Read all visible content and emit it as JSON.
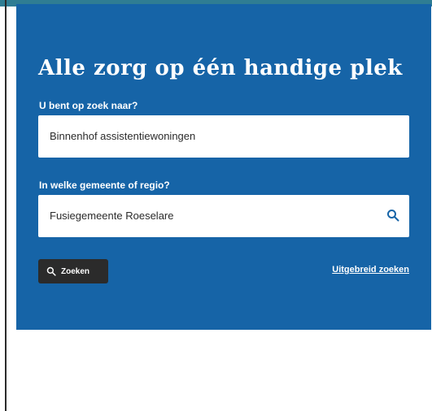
{
  "hero": {
    "title": "Alle zorg op één handige plek",
    "background_color": "#1664a7"
  },
  "search_form": {
    "what_label": "U bent op zoek naar?",
    "what_value": "Binnenhof assistentiewoningen",
    "where_label": "In welke gemeente of regio?",
    "where_value": "Fusiegemeente Roeselare",
    "where_icon": "search-icon",
    "submit_label": "Zoeken",
    "submit_icon": "search-icon",
    "advanced_link": "Uitgebreid zoeken"
  }
}
